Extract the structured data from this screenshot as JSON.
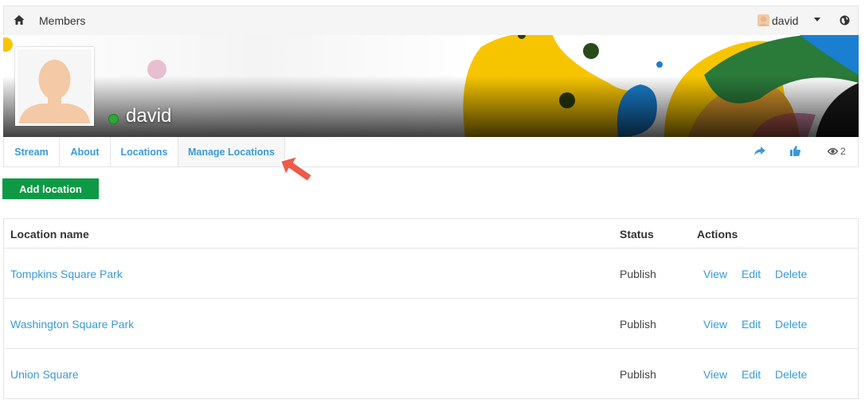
{
  "topbar": {
    "members_label": "Members",
    "user_name": "david"
  },
  "profile": {
    "name": "david",
    "status": "online"
  },
  "tabs": [
    {
      "label": "Stream"
    },
    {
      "label": "About"
    },
    {
      "label": "Locations"
    },
    {
      "label": "Manage Locations",
      "active": true
    }
  ],
  "actions": {
    "views_count": "2"
  },
  "add_button_label": "Add location",
  "table": {
    "headers": [
      "Location name",
      "Status",
      "Actions"
    ],
    "rows": [
      {
        "name": "Tompkins Square Park",
        "status": "Publish",
        "view": "View",
        "edit": "Edit",
        "delete": "Delete"
      },
      {
        "name": "Washington Square Park",
        "status": "Publish",
        "view": "View",
        "edit": "Edit",
        "delete": "Delete"
      },
      {
        "name": "Union Square",
        "status": "Publish",
        "view": "View",
        "edit": "Edit",
        "delete": "Delete"
      }
    ]
  },
  "colors": {
    "link": "#3a9ad9",
    "add_button": "#0e9a44",
    "online": "#2ea836",
    "annotation_arrow": "#ef5a4a"
  }
}
